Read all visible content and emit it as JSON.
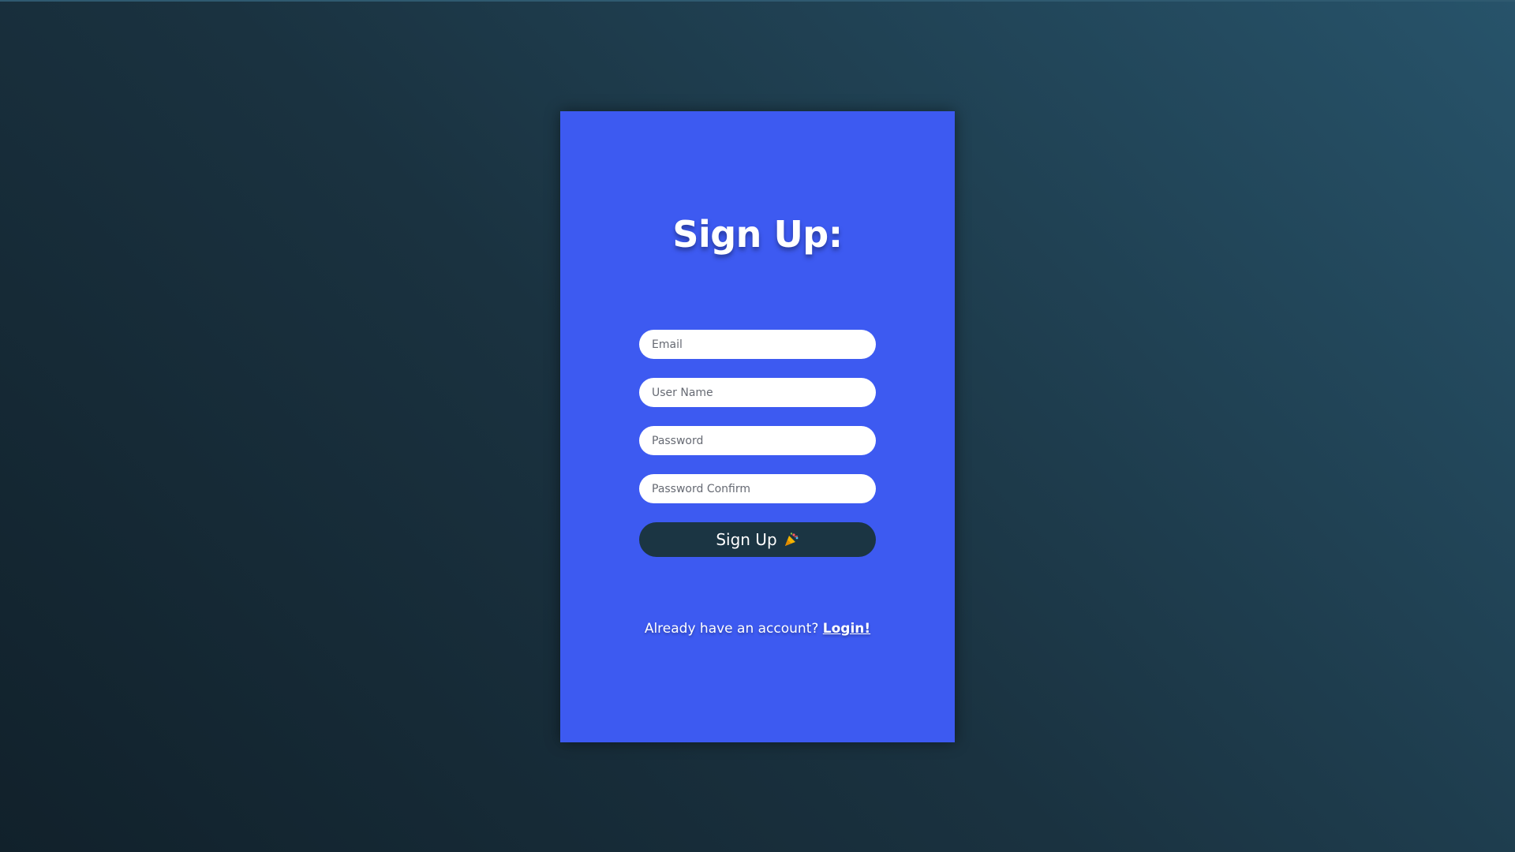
{
  "page": {
    "background_start": "#11212b",
    "background_end": "#27536a"
  },
  "card": {
    "background": "#3d5af1",
    "title": "Sign Up:"
  },
  "form": {
    "email_placeholder": "Email",
    "username_placeholder": "User Name",
    "password_placeholder": "Password",
    "password_confirm_placeholder": "Password Confirm",
    "submit_label": "Sign Up",
    "submit_icon": "party-popper-icon",
    "submit_color": "#1b3543"
  },
  "footer": {
    "prompt": "Already have an account?",
    "login_label": "Login!"
  }
}
